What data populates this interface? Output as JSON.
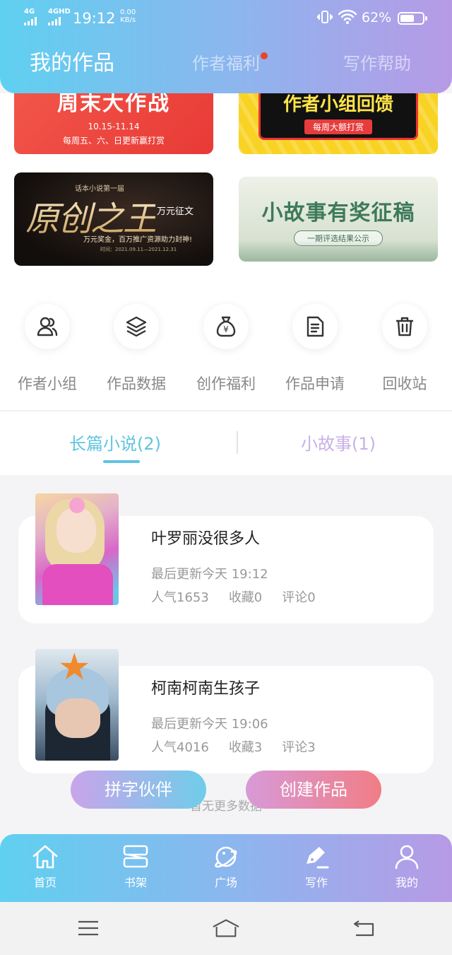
{
  "status_bar": {
    "network1": "4G",
    "network2": "4GHD",
    "time": "19:12",
    "speed_value": "0.00",
    "speed_unit": "KB/s",
    "battery": "62%",
    "battery_level": 0.62
  },
  "header": {
    "tabs": [
      {
        "label": "我的作品",
        "active": true
      },
      {
        "label": "作者福利",
        "active": false,
        "dot": true
      },
      {
        "label": "写作帮助",
        "active": false
      }
    ]
  },
  "banners": [
    {
      "title": "周末大作战",
      "line2": "10.15-11.14",
      "line3": "每周五、六、日更新赢打赏"
    },
    {
      "title": "作者小组回馈",
      "line2": "每周大额打赏"
    },
    {
      "top": "话本小说第一届",
      "title": "原创之王",
      "tag": "万元征文",
      "line2": "万元奖金，百万推广资源助力封神!",
      "line3": "时间：2021.09.11—2021.12.31"
    },
    {
      "title": "小故事有奖征稿",
      "line2": "一期评选结果公示"
    }
  ],
  "shortcuts": [
    {
      "label": "作者小组",
      "icon": "users-icon"
    },
    {
      "label": "作品数据",
      "icon": "layers-icon"
    },
    {
      "label": "创作福利",
      "icon": "money-bag-icon"
    },
    {
      "label": "作品申请",
      "icon": "document-icon"
    },
    {
      "label": "回收站",
      "icon": "trash-icon"
    }
  ],
  "sub_tabs": [
    {
      "label": "长篇小说(2)",
      "active": true
    },
    {
      "label": "小故事(1)",
      "active": false
    }
  ],
  "works": [
    {
      "title": "叶罗丽没很多人",
      "updated": "最后更新今天 19:12",
      "popularity": "人气1653",
      "favorites": "收藏0",
      "comments": "评论0"
    },
    {
      "title": "柯南柯南生孩子",
      "updated": "最后更新今天 19:06",
      "popularity": "人气4016",
      "favorites": "收藏3",
      "comments": "评论3"
    }
  ],
  "no_more": "暂无更多数据",
  "fab": {
    "partner": "拼字伙伴",
    "create": "创建作品"
  },
  "bottom_nav": [
    {
      "label": "首页",
      "icon": "home-icon"
    },
    {
      "label": "书架",
      "icon": "bookshelf-icon"
    },
    {
      "label": "广场",
      "icon": "planet-icon"
    },
    {
      "label": "写作",
      "icon": "pen-icon"
    },
    {
      "label": "我的",
      "icon": "user-icon"
    }
  ],
  "colors": {
    "accent": "#5fc4e0",
    "secondary": "#c8b0e6",
    "header_start": "#5fd0f0",
    "header_end": "#b79ae6"
  }
}
